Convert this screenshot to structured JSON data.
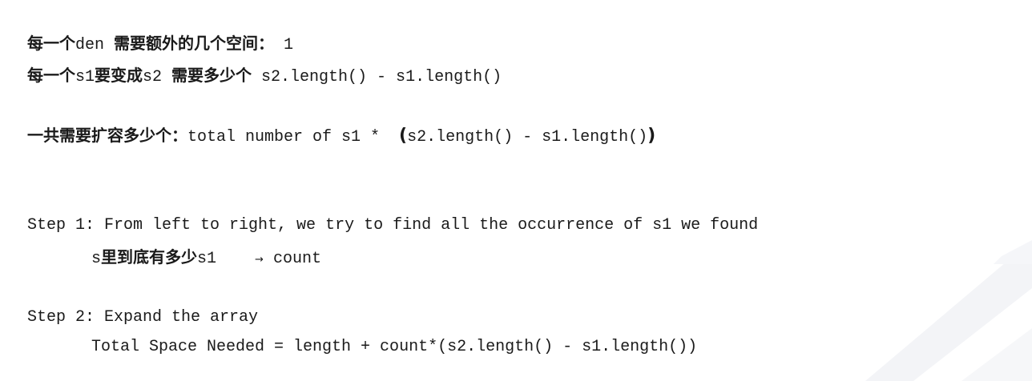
{
  "lines": {
    "l1": {
      "cjk_a": "每一个",
      "code_a": "den ",
      "cjk_b": "需要额外的几个空间：",
      "code_b": " 1"
    },
    "l2": {
      "cjk_a": "每一个",
      "code_a": "s1",
      "cjk_b": "要变成",
      "code_b": "s2 ",
      "cjk_c": "需要多少个",
      "code_c": " s2.length() - s1.length()"
    },
    "l3": {
      "cjk_a": "一共需要扩容多少个：",
      "code_a": "total number of s1 *  ",
      "paren_open": "(",
      "code_b": "s2.length() - s1.length()",
      "paren_close": ")"
    },
    "step1": {
      "text": "Step 1: From left to right, we try to find all the occurrence of s1 we found"
    },
    "step1_sub": {
      "code_a": "s",
      "cjk_a": "里到底有多少",
      "code_b": "s1    ",
      "arrow": "→",
      "code_c": " count"
    },
    "step2": {
      "text": "Step 2: Expand the array"
    },
    "step2_sub": {
      "text": "Total Space Needed = length + count*(s2.length() - s1.length())"
    }
  },
  "colors": {
    "text": "#1a1a1a",
    "decoration": "#f2f3f6"
  }
}
